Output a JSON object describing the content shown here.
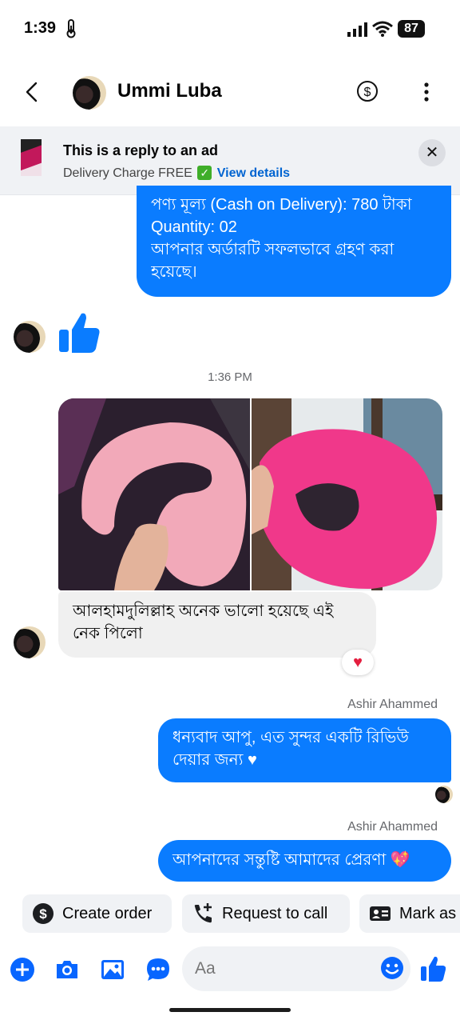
{
  "status": {
    "time": "1:39",
    "battery": "87"
  },
  "header": {
    "contact_name": "Ummi Luba"
  },
  "ad_banner": {
    "title": "This is a reply to an ad",
    "subtitle": "Delivery Charge FREE",
    "check": "✓",
    "link": "View details",
    "close": "✕"
  },
  "messages": {
    "order_lines": [
      "পণ্য মূল্য (Cash on Delivery): 780 টাকা",
      "Quantity: 02",
      "আপনার অর্ডারটি সফলভাবে গ্রহণ করা",
      "হয়েছে।"
    ],
    "timestamp": "1:36 PM",
    "review_text": "আলহামদুলিল্লাহ অনেক ভালো হয়েছে এই নেক পিলো",
    "reaction": "♥",
    "sender1": "Ashir Ahammed",
    "reply1": "ধন্যবাদ আপু, এত সুন্দর একটি রিভিউ দেয়ার জন্য ♥",
    "sender2": "Ashir Ahammed",
    "reply2": "আপনাদের সন্তুষ্টি আমাদের প্রেরণা 💖"
  },
  "quick_actions": [
    "Create order",
    "Request to call",
    "Mark as"
  ],
  "composer": {
    "placeholder": "Aa"
  },
  "colors": {
    "accent": "#0a7cff",
    "icon_blue": "#0866ff",
    "incoming": "#f0f0f0"
  },
  "icons": [
    "thermometer-icon",
    "signal-icon",
    "wifi-icon",
    "battery-icon",
    "back-icon",
    "dollar-icon",
    "more-icon",
    "thumbs-up-icon",
    "plus-icon",
    "camera-icon",
    "image-icon",
    "chat-icon",
    "emoji-icon",
    "like-icon"
  ]
}
